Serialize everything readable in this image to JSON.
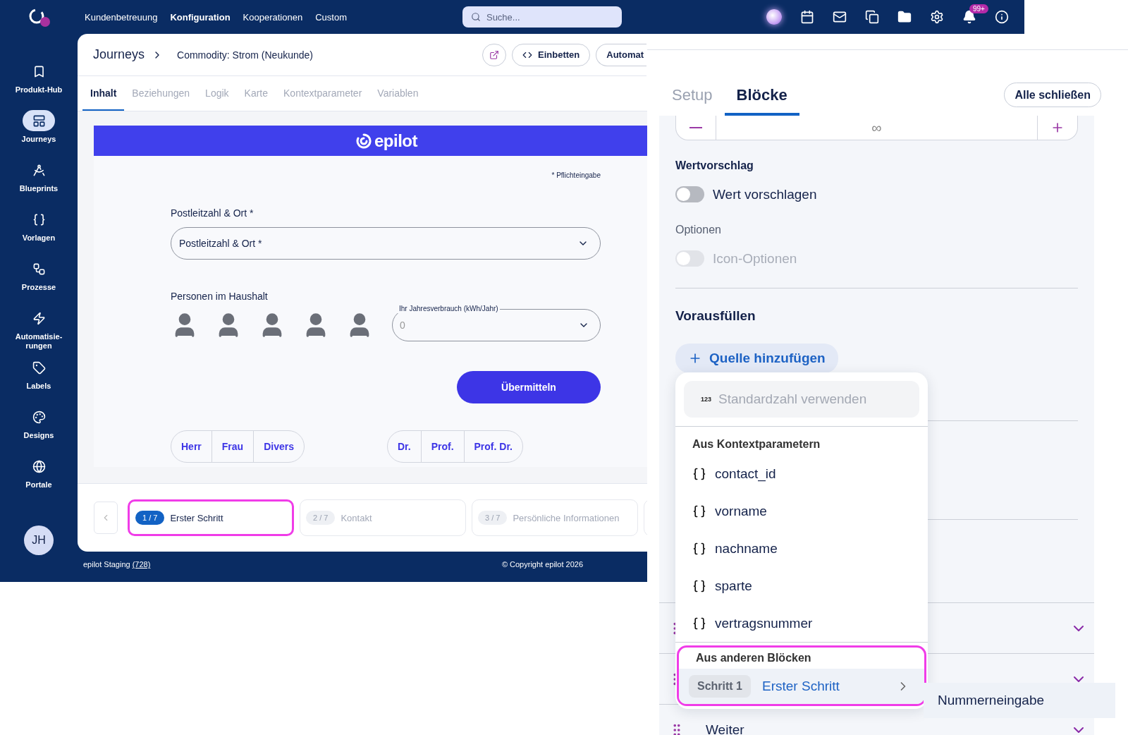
{
  "top_nav": {
    "links": [
      {
        "label": "Kundenbetreuung",
        "selected": false
      },
      {
        "label": "Konfiguration",
        "selected": true
      },
      {
        "label": "Kooperationen",
        "selected": false
      },
      {
        "label": "Custom",
        "selected": false
      }
    ],
    "search": {
      "placeholder": "Suche..."
    },
    "notification_badge": "99+"
  },
  "sidebar": {
    "items": [
      {
        "label": "Produkt-Hub",
        "selected": false
      },
      {
        "label": "Journeys",
        "selected": true
      },
      {
        "label": "Blueprints",
        "selected": false
      },
      {
        "label": "Vorlagen",
        "selected": false
      },
      {
        "label": "Prozesse",
        "selected": false
      },
      {
        "label": "Automatisie-rungen",
        "selected": false
      },
      {
        "label": "Labels",
        "selected": false
      },
      {
        "label": "Designs",
        "selected": false
      },
      {
        "label": "Portale",
        "selected": false
      }
    ],
    "avatar": "JH"
  },
  "header": {
    "breadcrumb_root": "Journeys",
    "title": "Commodity: Strom (Neukunde)",
    "buttons": [
      "Einbetten",
      "Automat"
    ]
  },
  "tabs": [
    {
      "label": "Inhalt",
      "selected": true
    },
    {
      "label": "Beziehungen",
      "selected": false
    },
    {
      "label": "Logik",
      "selected": false
    },
    {
      "label": "Karte",
      "selected": false
    },
    {
      "label": "Kontextparameter",
      "selected": false
    },
    {
      "label": "Variablen",
      "selected": false
    }
  ],
  "preview": {
    "brand": "epilot",
    "required_note": "* Pflichteingabe",
    "address_label": "Postleitzahl & Ort *",
    "address_select": "Postleitzahl & Ort *",
    "persons_label": "Personen im Haushalt",
    "persons": [
      {
        "selected": false
      },
      {
        "selected": false
      },
      {
        "selected": false
      },
      {
        "selected": false
      },
      {
        "selected": false
      }
    ],
    "consumption": {
      "label": "Ihr Jahresverbrauch (kWh/Jahr)",
      "value": "0"
    },
    "submit": "Übermitteln",
    "salutations": [
      "Herr",
      "Frau",
      "Divers"
    ],
    "titles": [
      "Dr.",
      "Prof.",
      "Prof. Dr."
    ]
  },
  "steps": [
    {
      "badge": "1 / 7",
      "label": "Erster Schritt",
      "selected": true,
      "highlighted": true
    },
    {
      "badge": "2 / 7",
      "label": "Kontakt",
      "selected": false,
      "highlighted": false
    },
    {
      "badge": "3 / 7",
      "label": "Persönliche Informationen",
      "selected": false,
      "highlighted": false
    }
  ],
  "footer": {
    "environment": "epilot Staging",
    "environment_link": "(728)",
    "copyright": "© Copyright epilot 2026"
  },
  "panel": {
    "tabs": [
      {
        "label": "Setup",
        "selected": false
      },
      {
        "label": "Blöcke",
        "selected": true
      }
    ],
    "close_all": "Alle schließen",
    "stepper": {
      "value": "∞"
    },
    "value_suggestion": {
      "heading": "Wertvorschlag",
      "toggle": {
        "label": "Wert vorschlagen",
        "on": false,
        "disabled": false
      }
    },
    "options": {
      "heading": "Optionen",
      "toggle": {
        "label": "Icon-Optionen",
        "on": false,
        "disabled": true
      }
    },
    "prefill": {
      "heading": "Vorausfüllen",
      "add_source": "Quelle hinzufügen"
    },
    "menu": {
      "default_item": {
        "icon_text": "123",
        "label": "Standardzahl verwenden",
        "disabled": true
      },
      "context_group": {
        "heading": "Aus Kontextparametern",
        "items": [
          "contact_id",
          "vorname",
          "nachname",
          "sparte",
          "vertragsnummer"
        ]
      },
      "blocks_group": {
        "heading": "Aus anderen Blöcken",
        "highlighted": true,
        "item": {
          "tag": "Schritt 1",
          "label": "Erster Schritt"
        }
      },
      "submenu_item": "Nummerneingabe"
    },
    "rows": [
      {},
      {},
      {
        "label": "Weiter"
      }
    ]
  }
}
